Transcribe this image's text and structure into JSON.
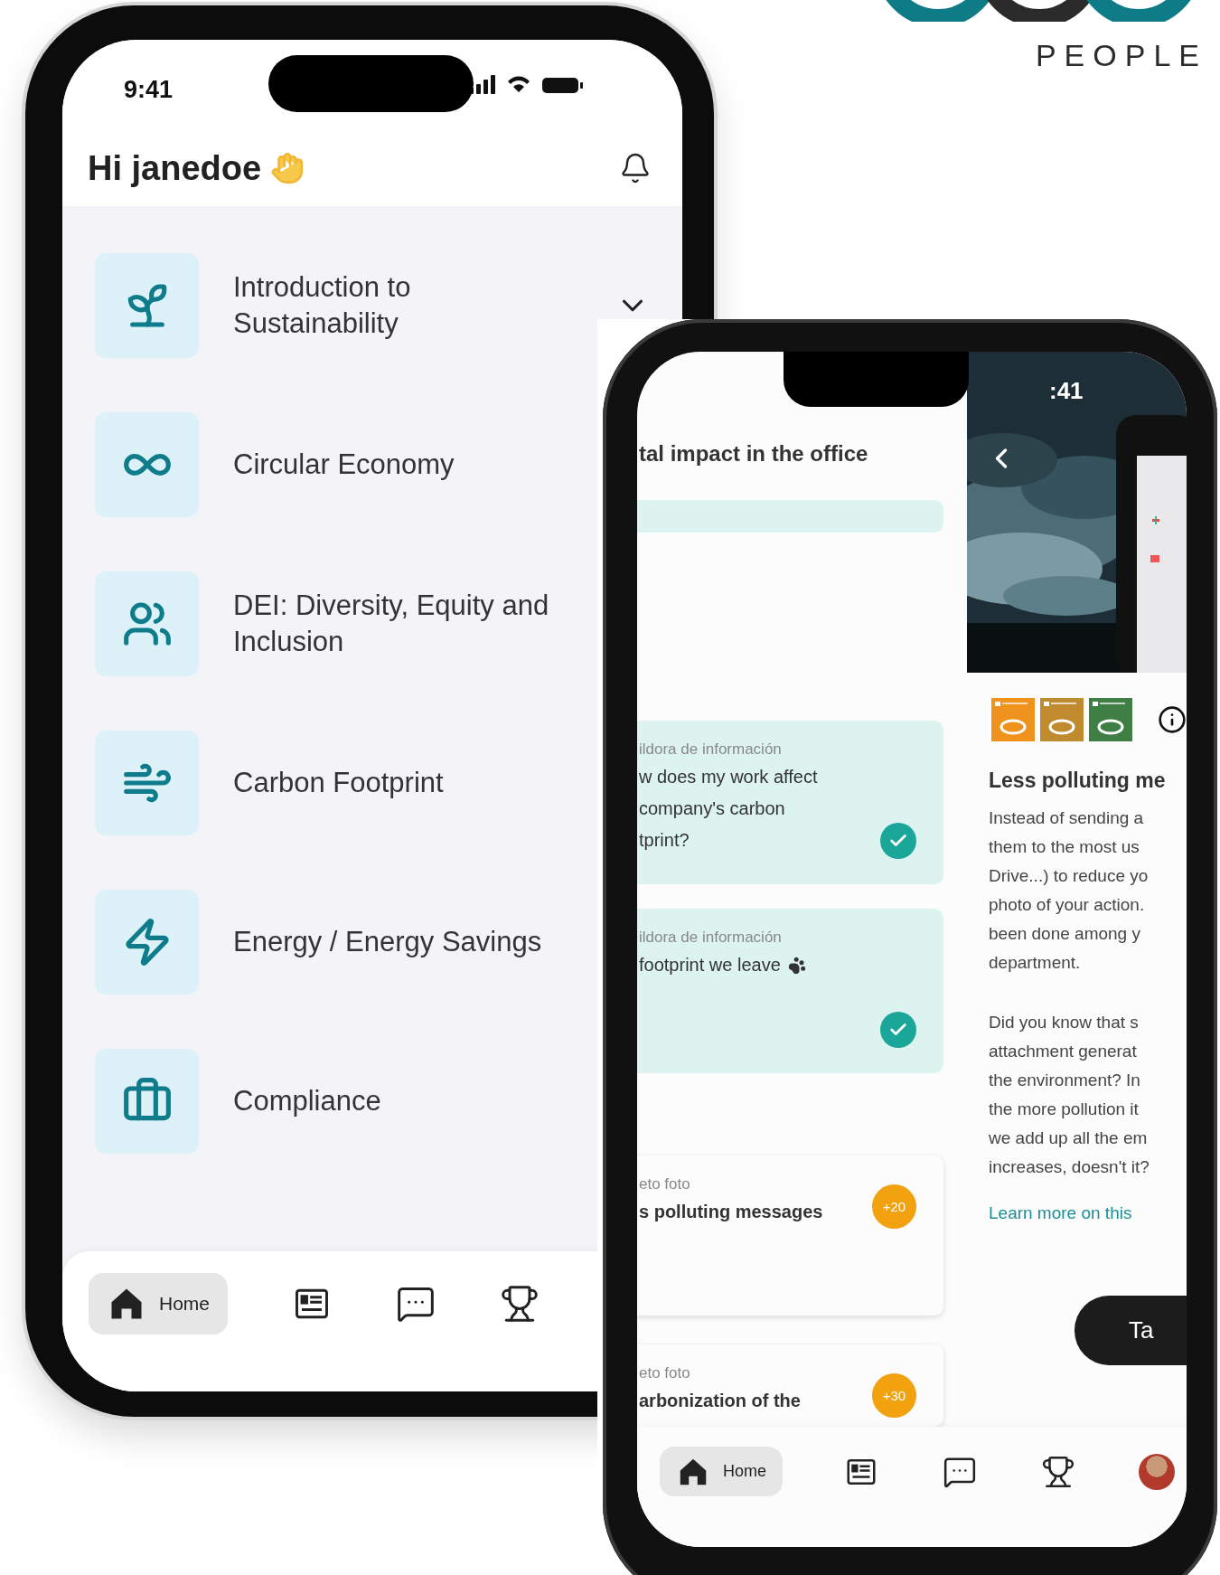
{
  "logo": {
    "text": "PEOPLE"
  },
  "home_phone": {
    "status_time": "9:41",
    "greeting": "Hi janedoe",
    "topics": [
      {
        "title": "Introduction to Sustainability",
        "expanded": false
      },
      {
        "title": "Circular Economy"
      },
      {
        "title": "DEI: Diversity, Equity and Inclusion"
      },
      {
        "title": "Carbon Footprint"
      },
      {
        "title": "Energy / Energy Savings"
      },
      {
        "title": "Compliance"
      }
    ],
    "nav": [
      {
        "kind": "home",
        "label": "Home",
        "selected": true
      },
      {
        "kind": "news",
        "selected": false
      },
      {
        "kind": "chat",
        "selected": false
      },
      {
        "kind": "trophy",
        "selected": false
      }
    ]
  },
  "challenge_phone": {
    "list_title": "tal impact in the office",
    "cards": [
      {
        "kind": "pill"
      },
      {
        "kind": "pill",
        "category": "ildora de información",
        "lines": [
          "w does my work affect",
          "company's carbon",
          "tprint?"
        ],
        "completed": true
      },
      {
        "kind": "pill",
        "category": "ildora de información",
        "lines": [
          "footprint we leave"
        ],
        "icon_after": true,
        "completed": true
      },
      {
        "kind": "challenge",
        "category": "eto foto",
        "lines": [
          "s polluting messages"
        ],
        "points": "+20"
      },
      {
        "kind": "challenge",
        "category": "eto foto",
        "lines": [
          "arbonization of the"
        ],
        "points": "+30"
      }
    ],
    "detail": {
      "status_time": ":41",
      "sdg_icons": [
        {
          "color": "#f0921e"
        },
        {
          "color": "#bf8b2e"
        },
        {
          "color": "#3f7e44"
        }
      ],
      "title": "Less polluting me",
      "paragraphs": [
        [
          "Instead of sending a",
          "them to the most us",
          "Drive...) to reduce yo",
          "photo of your action.",
          "been done among y",
          "department."
        ],
        [
          "Did you know that s",
          "attachment generat",
          "the environment? In",
          "the more pollution it",
          "we add up all the em",
          "increases, doesn't it?"
        ]
      ],
      "link": "Learn more on this",
      "button": "Ta"
    },
    "nav": [
      {
        "kind": "home",
        "label": "Home",
        "selected": true
      },
      {
        "kind": "news",
        "selected": false
      },
      {
        "kind": "chat",
        "selected": false
      },
      {
        "kind": "trophy",
        "selected": false
      },
      {
        "kind": "avatar",
        "selected": false
      }
    ]
  }
}
